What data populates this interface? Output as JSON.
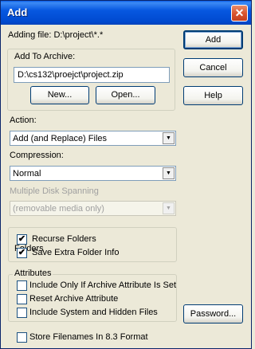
{
  "window": {
    "title": "Add",
    "close_glyph": "✕"
  },
  "adding_file_label": "Adding file: D:\\project\\*.*",
  "archive_group": {
    "legend": "Add To Archive:",
    "path_value": "D:\\cs132\\proejct\\project.zip",
    "new_button": "New...",
    "open_button": "Open..."
  },
  "buttons": {
    "add": "Add",
    "cancel": "Cancel",
    "help": "Help",
    "password": "Password..."
  },
  "action": {
    "label": "Action:",
    "selected": "Add (and Replace) Files"
  },
  "compression": {
    "label": "Compression:",
    "selected": "Normal"
  },
  "spanning": {
    "label": "Multiple Disk Spanning",
    "selected": "(removable media only)"
  },
  "folders": {
    "legend": "Folders",
    "items": [
      {
        "label": "Recurse Folders",
        "checked": true
      },
      {
        "label": "Save Extra Folder Info",
        "checked": true
      }
    ]
  },
  "attributes": {
    "legend": "Attributes",
    "items": [
      {
        "label": "Include Only If Archive Attribute Is Set",
        "checked": false
      },
      {
        "label": "Reset Archive Attribute",
        "checked": false
      },
      {
        "label": "Include System and Hidden Files",
        "checked": false
      }
    ]
  },
  "store_83": {
    "label": "Store Filenames In 8.3 Format",
    "checked": false
  },
  "glyphs": {
    "check": "✔",
    "dropdown_arrow": "▼"
  }
}
